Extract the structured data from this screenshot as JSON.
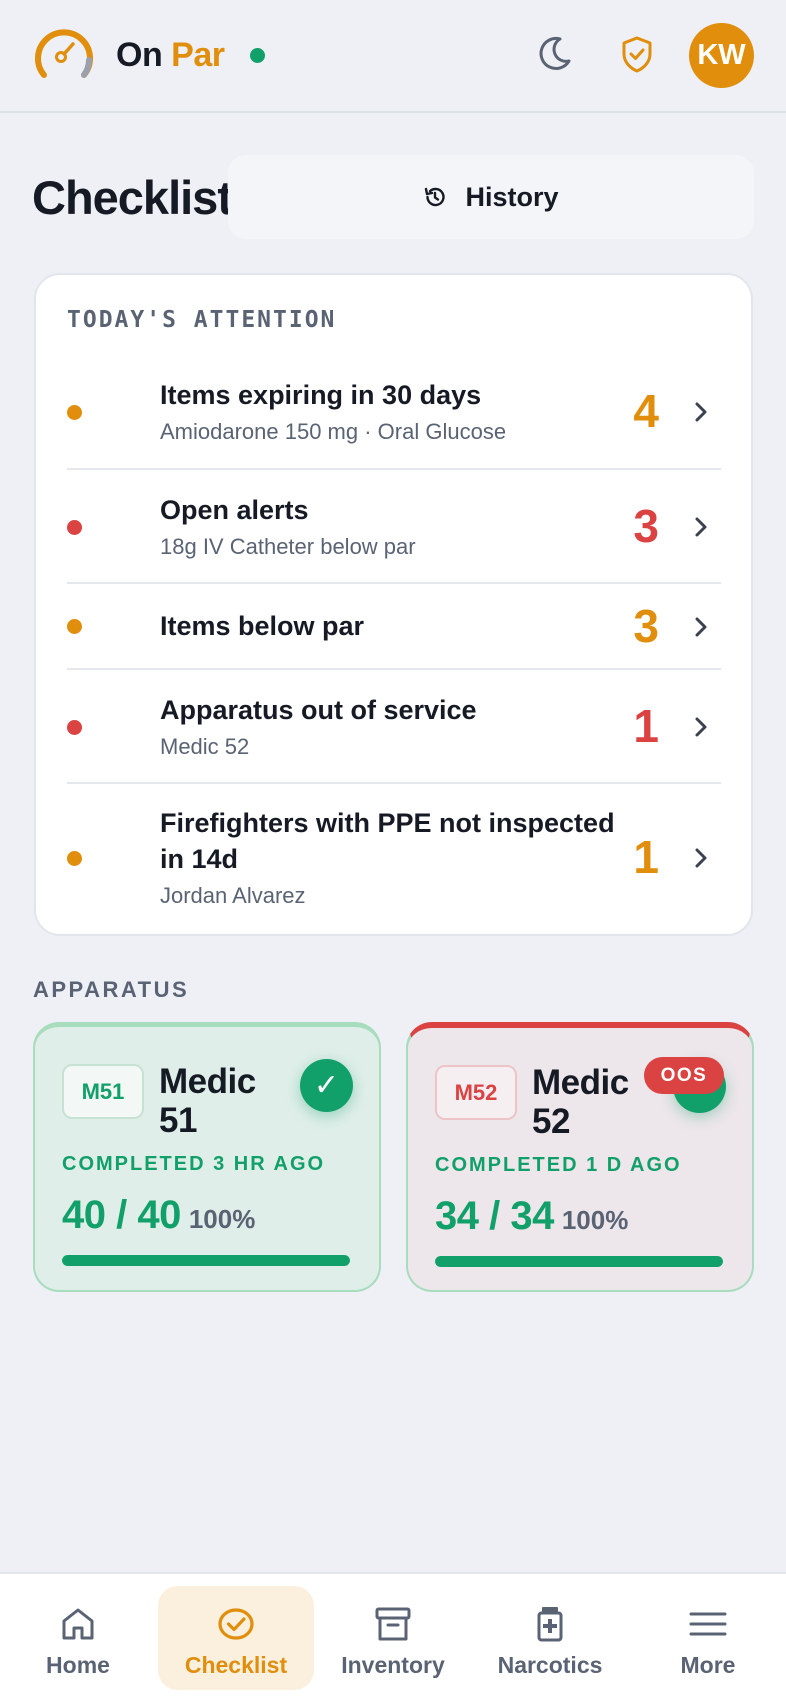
{
  "brand": {
    "name_part1": "On",
    "name_part2": "Par"
  },
  "header": {
    "avatar_initials": "KW"
  },
  "page": {
    "title": "Checklist",
    "history_label": "History"
  },
  "attention": {
    "title": "TODAY'S ATTENTION",
    "items": [
      {
        "label": "Items expiring in 30 days",
        "sub": "Amiodarone 150 mg · Oral Glucose",
        "count": "4",
        "severity": "warning"
      },
      {
        "label": "Open alerts",
        "sub": "18g IV Catheter below par",
        "count": "3",
        "severity": "danger"
      },
      {
        "label": "Items below par",
        "sub": "",
        "count": "3",
        "severity": "warning"
      },
      {
        "label": "Apparatus out of service",
        "sub": "Medic 52",
        "count": "1",
        "severity": "danger"
      },
      {
        "label": "Firefighters with PPE not inspected in 14d",
        "sub": "Jordan Alvarez",
        "count": "1",
        "severity": "warning"
      }
    ]
  },
  "apparatus": {
    "title": "APPARATUS",
    "units": [
      {
        "badge": "M51",
        "name": "Medic 51",
        "status": "",
        "completed": "COMPLETED 3 HR AGO",
        "count_done": "40",
        "count_total": "40",
        "percent": "100%",
        "progress": 1.0
      },
      {
        "badge": "M52",
        "name": "Medic 52",
        "status": "OOS",
        "completed": "COMPLETED 1 D AGO",
        "count_done": "34",
        "count_total": "34",
        "percent": "100%",
        "progress": 1.0
      }
    ]
  },
  "nav": {
    "items": [
      {
        "label": "Home",
        "icon": "home-icon"
      },
      {
        "label": "Checklist",
        "icon": "checklist-icon",
        "active": true
      },
      {
        "label": "Inventory",
        "icon": "inventory-icon"
      },
      {
        "label": "Narcotics",
        "icon": "narcotics-icon"
      },
      {
        "label": "More",
        "icon": "menu-icon"
      }
    ]
  },
  "colors": {
    "accent": "#e08e0b",
    "success": "#12a06a",
    "danger": "#db4343",
    "text": "#151a24",
    "muted": "#5a6374",
    "background": "#eef0f5"
  }
}
